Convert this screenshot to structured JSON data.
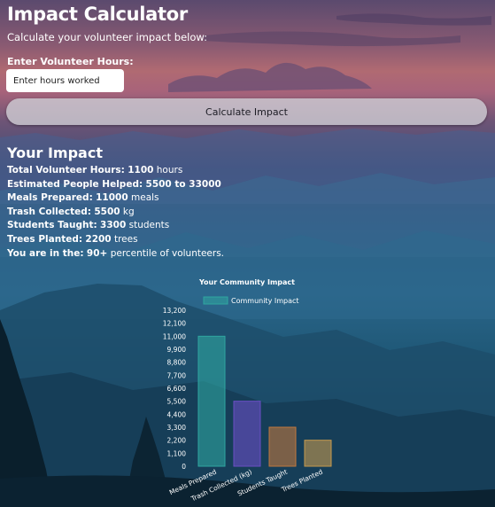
{
  "app": {
    "title": "Impact Calculator",
    "subtitle": "Calculate your volunteer impact below:"
  },
  "form": {
    "hours_label": "Enter Volunteer Hours:",
    "hours_placeholder": "Enter hours worked",
    "calculate_label": "Calculate Impact"
  },
  "results": {
    "heading": "Your Impact",
    "lines": [
      {
        "label": "Total Volunteer Hours:",
        "value": "1100",
        "suffix": "hours"
      },
      {
        "label": "Estimated People Helped:",
        "value": "5500 to 33000",
        "suffix": ""
      },
      {
        "label": "Meals Prepared:",
        "value": "11000",
        "suffix": "meals"
      },
      {
        "label": "Trash Collected:",
        "value": "5500",
        "suffix": "kg"
      },
      {
        "label": "Students Taught:",
        "value": "3300",
        "suffix": "students"
      },
      {
        "label": "Trees Planted:",
        "value": "2200",
        "suffix": "trees"
      },
      {
        "label": "You are in the:",
        "value": "90+",
        "suffix": "percentile of volunteers."
      }
    ]
  },
  "chart_data": {
    "type": "bar",
    "title": "Your Community Impact",
    "legend_position": "top",
    "categories": [
      "Meals Prepared",
      "Trash Collected (kg)",
      "Students Taught",
      "Trees Planted"
    ],
    "series": [
      {
        "name": "Community Impact",
        "values": [
          11000,
          5500,
          3300,
          2200
        ]
      }
    ],
    "ylim": [
      0,
      13200
    ],
    "yticks": [
      0,
      1100,
      2200,
      3300,
      4400,
      5500,
      6600,
      7700,
      8800,
      9900,
      11000,
      12100,
      13200
    ],
    "ytick_labels": [
      "0",
      "1,100",
      "2,200",
      "3,300",
      "4,400",
      "5,500",
      "6,600",
      "7,700",
      "8,800",
      "9,900",
      "11,000",
      "12,100",
      "13,200"
    ],
    "colors": [
      "#2fa6a0",
      "#6a4fc4",
      "#c0783e",
      "#c59a4e"
    ],
    "legend_color": "#2fa6a0",
    "grid": false
  }
}
